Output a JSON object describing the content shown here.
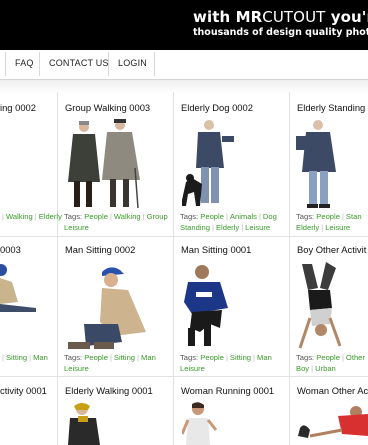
{
  "banner": {
    "line1_with": "with MR",
    "line1_cutout": "CUTOUT",
    "line1_rest": " you're",
    "line2": "thousands of design quality photo cu"
  },
  "nav": {
    "items": [
      "FAQ",
      "CONTACT US",
      "LOGIN"
    ]
  },
  "tags_label": "Tags:",
  "row1": [
    {
      "title": "ing 0002",
      "tags": [
        "Walking",
        "Elderly"
      ]
    },
    {
      "title": "Group Walking 0003",
      "tags": [
        "People",
        "Walking",
        "Group"
      ],
      "tags2": [
        "Leisure"
      ]
    },
    {
      "title": "Elderly Dog 0002",
      "tags": [
        "People",
        "Animals",
        "Dog"
      ],
      "tags2": [
        "Standing",
        "Elderly",
        "Leisure"
      ]
    },
    {
      "title": "Elderly Standing (",
      "tags": [
        "People",
        "Stan"
      ],
      "tags2": [
        "Elderly",
        "Leisure"
      ]
    }
  ],
  "row2": [
    {
      "title": "0003",
      "tags": [
        "Sitting",
        "Man"
      ]
    },
    {
      "title": "Man Sitting 0002",
      "tags": [
        "People",
        "Sitting",
        "Man"
      ],
      "tags2": [
        "Leisure"
      ]
    },
    {
      "title": "Man Sitting 0001",
      "tags": [
        "People",
        "Sitting",
        "Man"
      ],
      "tags2": [
        "Leisure"
      ]
    },
    {
      "title": "Boy Other Activit",
      "tags": [
        "People",
        "Other"
      ],
      "tags2": [
        "Boy",
        "Urban"
      ]
    }
  ],
  "row3": [
    {
      "title": "ctivity 0001"
    },
    {
      "title": "Elderly Walking 0001"
    },
    {
      "title": "Woman Running 0001"
    },
    {
      "title": "Woman Other Ac"
    }
  ],
  "colors": {
    "tag": "#3a9a2a",
    "banner": "#000000"
  }
}
